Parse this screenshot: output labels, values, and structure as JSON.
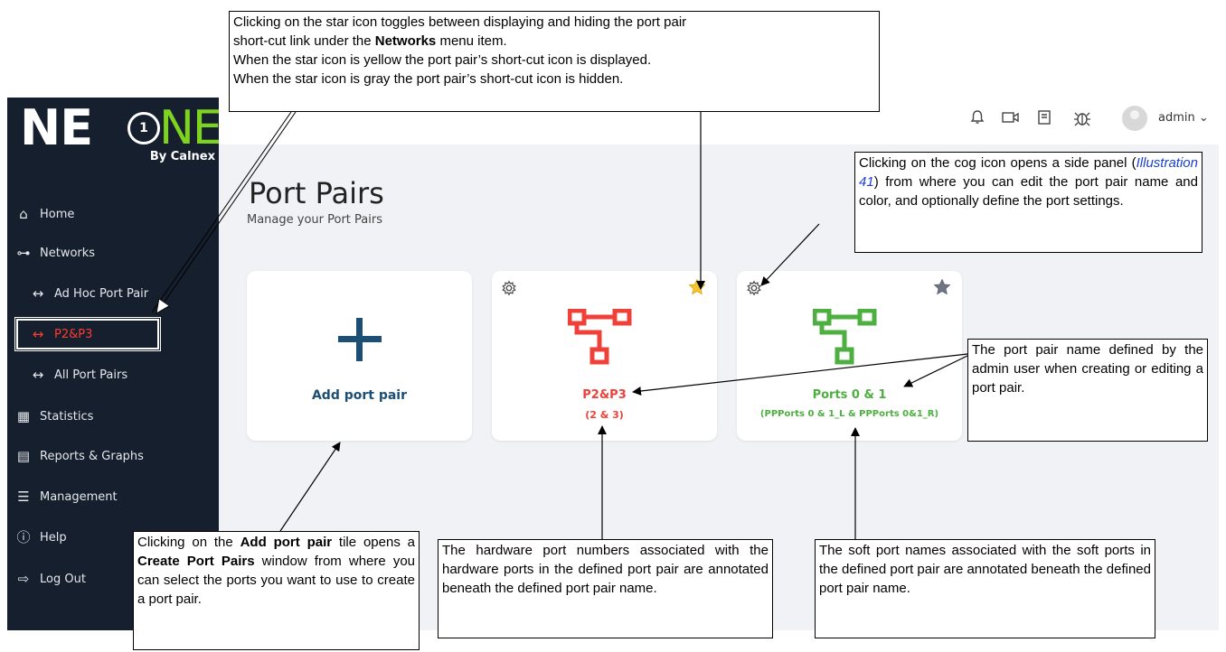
{
  "logo": {
    "part1": "NE",
    "circle": "1",
    "part2": "NE",
    "by": "By Calnex"
  },
  "nav": {
    "home": "Home",
    "networks": "Networks",
    "adhoc": "Ad Hoc Port Pair",
    "p2p3": "P2&P3",
    "allpairs": "All Port Pairs",
    "statistics": "Statistics",
    "reports": "Reports & Graphs",
    "management": "Management",
    "help": "Help",
    "logout": "Log Out"
  },
  "topbar": {
    "user": "admin ⌄",
    "icons": [
      "bell-icon",
      "video-icon",
      "book-icon",
      "bug-icon"
    ]
  },
  "page": {
    "title": "Port Pairs",
    "subtitle": "Manage your Port Pairs"
  },
  "tiles": [
    {
      "name": "Add port pair",
      "color": "#1d4e74"
    },
    {
      "name": "P2&P3",
      "ports": "(2 & 3)",
      "color": "#f0403a",
      "star": "yellow"
    },
    {
      "name": "Ports 0 & 1",
      "ports": "(PPPorts 0 & 1_L & PPPorts 0&1_R)",
      "color": "#4caf3f",
      "star": "gray"
    }
  ],
  "callouts": {
    "star": {
      "l1a": "Clicking on the star icon toggles between displaying and hiding the port pair",
      "l2a": "short-cut link under the ",
      "l2b": "Networks",
      "l2c": " menu item.",
      "l3": "When the star icon is yellow the port pair’s short-cut icon is displayed.",
      "l4": "When the star icon is gray the port pair’s short-cut icon is hidden."
    },
    "cog": {
      "a": "Clicking on the cog icon opens a side panel (",
      "link": "Illustration 41",
      "b": ") from where you can edit the port pair name and color, and optionally define the port settings."
    },
    "name": "The port pair name defined by the admin user when creating or editing a port pair.",
    "add": {
      "a": "Clicking on the ",
      "b": "Add port pair",
      "c": " tile opens a ",
      "d": "Create Port Pairs",
      "e": " window from where you can select the ports you want to use to create a port pair."
    },
    "hw": "The hardware port numbers associated with the hardware ports in the defined port pair are annotated beneath the defined port pair name.",
    "soft": "The soft port names associated with the soft ports in the defined port pair are annotated beneath the defined port pair name."
  }
}
